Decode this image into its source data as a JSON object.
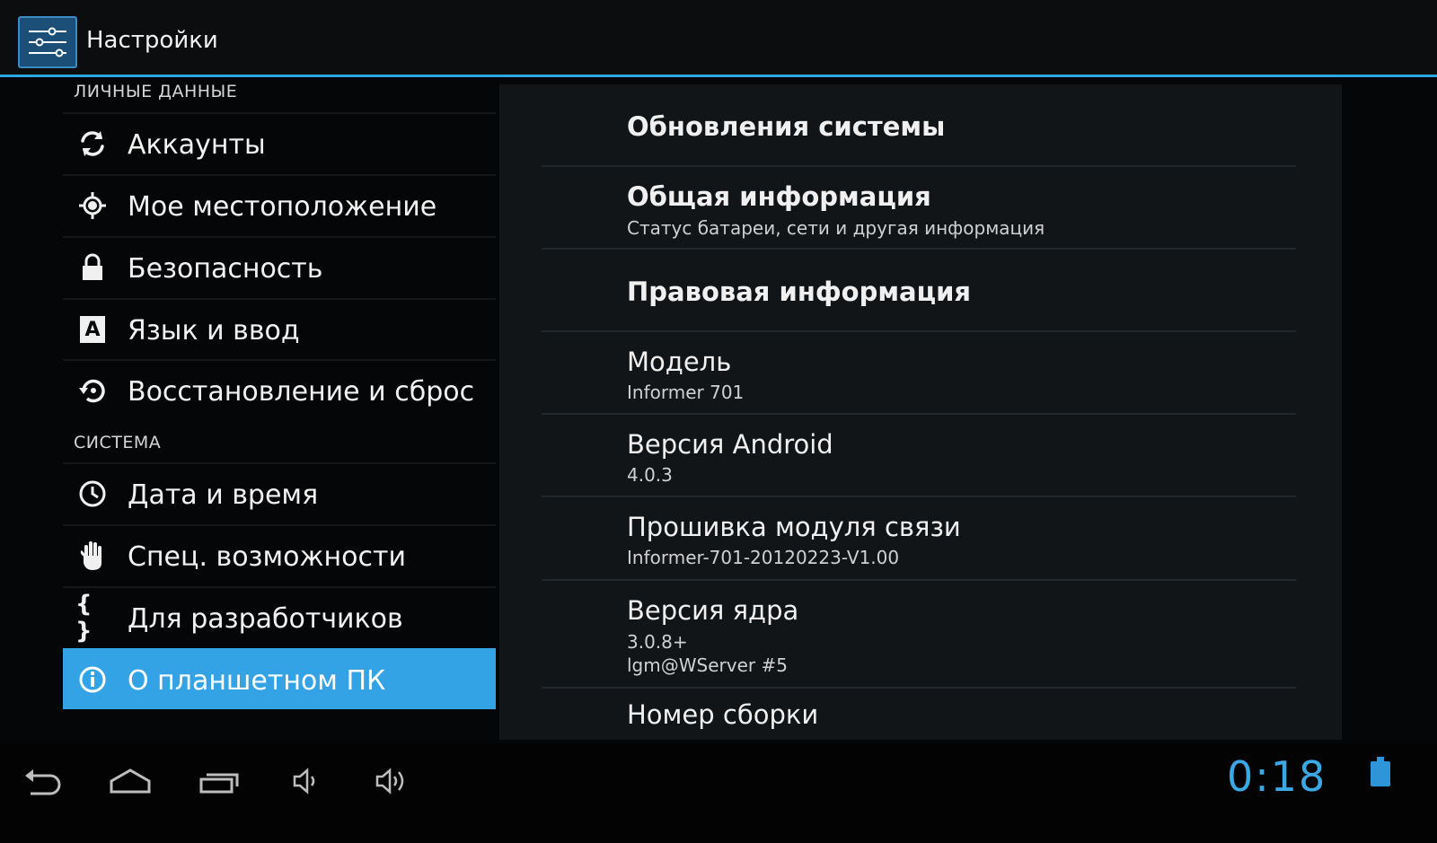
{
  "app": {
    "title": "Настройки",
    "icon": "settings-sliders-icon"
  },
  "nav": {
    "headers": {
      "personal": "ЛИЧНЫЕ ДАННЫЕ",
      "system": "СИСТЕМА"
    },
    "items": [
      {
        "label": "Аккаунты",
        "icon": "sync-icon"
      },
      {
        "label": "Мое местоположение",
        "icon": "location-icon"
      },
      {
        "label": "Безопасность",
        "icon": "lock-icon"
      },
      {
        "label": "Язык и ввод",
        "icon": "language-icon",
        "glyph": "A"
      },
      {
        "label": "Восстановление и сброс",
        "icon": "restore-icon"
      },
      {
        "label": "Дата и время",
        "icon": "clock-icon"
      },
      {
        "label": "Спец. возможности",
        "icon": "hand-icon"
      },
      {
        "label": "Для разработчиков",
        "icon": "braces-icon",
        "glyph": "{ }"
      },
      {
        "label": "О планшетном ПК",
        "icon": "info-icon",
        "selected": true
      }
    ],
    "accent": "#34a3e6"
  },
  "panel": {
    "rows": [
      {
        "title": "Обновления системы",
        "subtitle": ""
      },
      {
        "title": "Общая информация",
        "subtitle": "Статус батареи, сети и другая информация"
      },
      {
        "title": "Правовая информация",
        "subtitle": ""
      },
      {
        "title": "Модель",
        "subtitle": "Informer 701"
      },
      {
        "title": "Версия Android",
        "subtitle": "4.0.3"
      },
      {
        "title": "Прошивка модуля связи",
        "subtitle": "Informer-701-20120223-V1.00"
      },
      {
        "title": "Версия ядра",
        "subtitle": "3.0.8+",
        "subtitle2": "lgm@WServer #5"
      },
      {
        "title": "Номер сборки",
        "subtitle": ""
      }
    ]
  },
  "systembar": {
    "buttons": [
      "back-icon",
      "home-icon",
      "recent-apps-icon",
      "volume-down-icon",
      "volume-up-icon"
    ],
    "clock": "0:18",
    "clock_color": "#39a9e6",
    "battery": "battery-icon"
  }
}
